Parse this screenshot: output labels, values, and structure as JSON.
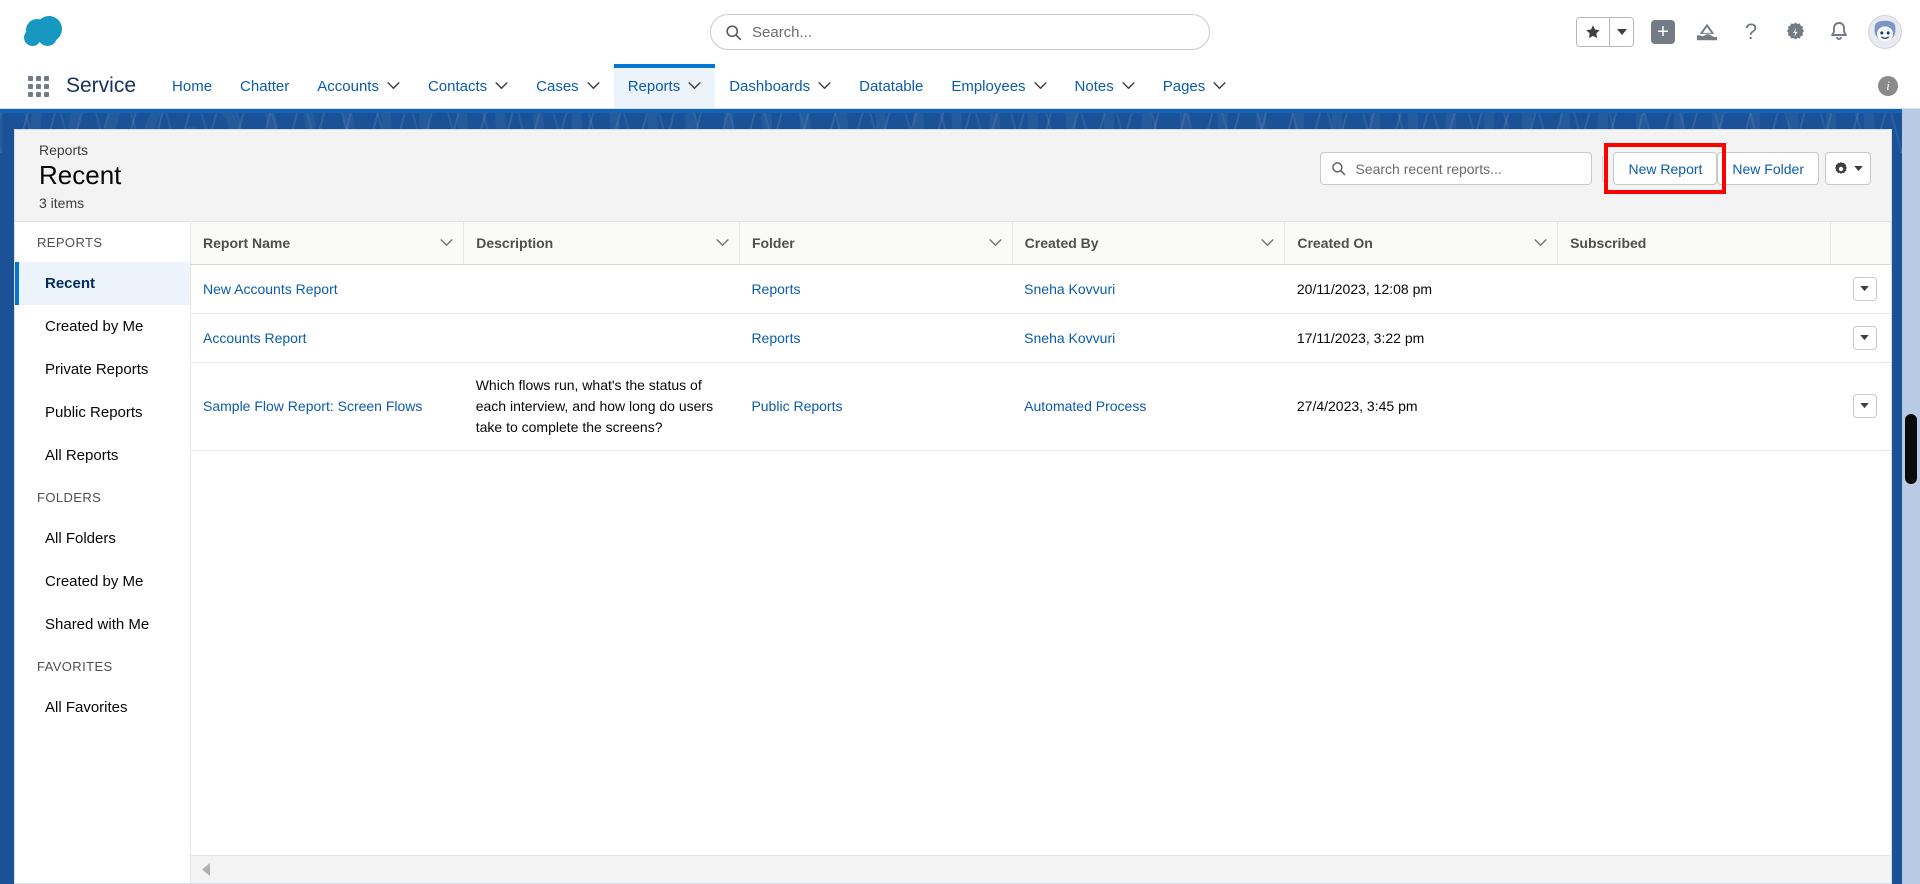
{
  "global": {
    "logo_name": "salesforce-cloud-logo",
    "search_placeholder": "Search...",
    "icons": [
      {
        "name": "favorites-star-icon",
        "label": "Favorites"
      },
      {
        "name": "favorites-caret-icon",
        "label": "Favorites list"
      },
      {
        "name": "add-plus-icon",
        "label": "Global Actions"
      },
      {
        "name": "trailhead-icon",
        "label": "Trailhead"
      },
      {
        "name": "help-question-icon",
        "label": "Help"
      },
      {
        "name": "setup-gear-icon",
        "label": "Setup"
      },
      {
        "name": "notifications-bell-icon",
        "label": "Notifications"
      },
      {
        "name": "user-avatar",
        "label": "User profile"
      }
    ]
  },
  "appnav": {
    "waffle_label": "App Launcher",
    "app_name": "Service",
    "info_icon": "info-icon",
    "items": [
      {
        "label": "Home",
        "has_menu": false,
        "active": false
      },
      {
        "label": "Chatter",
        "has_menu": false,
        "active": false
      },
      {
        "label": "Accounts",
        "has_menu": true,
        "active": false
      },
      {
        "label": "Contacts",
        "has_menu": true,
        "active": false
      },
      {
        "label": "Cases",
        "has_menu": true,
        "active": false
      },
      {
        "label": "Reports",
        "has_menu": true,
        "active": true
      },
      {
        "label": "Dashboards",
        "has_menu": true,
        "active": false
      },
      {
        "label": "Datatable",
        "has_menu": false,
        "active": false
      },
      {
        "label": "Employees",
        "has_menu": true,
        "active": false
      },
      {
        "label": "Notes",
        "has_menu": true,
        "active": false
      },
      {
        "label": "Pages",
        "has_menu": true,
        "active": false
      }
    ]
  },
  "page": {
    "breadcrumb": "Reports",
    "title": "Recent",
    "item_count": "3 items",
    "search_placeholder": "Search recent reports...",
    "new_report_label": "New Report",
    "new_folder_label": "New Folder",
    "gear_label": "List View Controls",
    "highlight_color": "#fe0000",
    "accent_color": "#0176d3",
    "link_color": "#0b5cab"
  },
  "sidebar": {
    "groups": [
      {
        "title": "REPORTS",
        "items": [
          {
            "label": "Recent",
            "active": true
          },
          {
            "label": "Created by Me",
            "active": false
          },
          {
            "label": "Private Reports",
            "active": false
          },
          {
            "label": "Public Reports",
            "active": false
          },
          {
            "label": "All Reports",
            "active": false
          }
        ]
      },
      {
        "title": "FOLDERS",
        "items": [
          {
            "label": "All Folders",
            "active": false
          },
          {
            "label": "Created by Me",
            "active": false
          },
          {
            "label": "Shared with Me",
            "active": false
          }
        ]
      },
      {
        "title": "FAVORITES",
        "items": [
          {
            "label": "All Favorites",
            "active": false
          }
        ]
      }
    ]
  },
  "table": {
    "columns": [
      {
        "label": "Report Name",
        "has_menu": true
      },
      {
        "label": "Description",
        "has_menu": true
      },
      {
        "label": "Folder",
        "has_menu": true
      },
      {
        "label": "Created By",
        "has_menu": true
      },
      {
        "label": "Created On",
        "has_menu": true
      },
      {
        "label": "Subscribed",
        "has_menu": false
      }
    ],
    "rows": [
      {
        "report_name": "New Accounts Report",
        "description": "",
        "folder": "Reports",
        "created_by": "Sneha Kovvuri",
        "created_on": "20/11/2023, 12:08 pm",
        "subscribed": ""
      },
      {
        "report_name": "Accounts Report",
        "description": "",
        "folder": "Reports",
        "created_by": "Sneha Kovvuri",
        "created_on": "17/11/2023, 3:22 pm",
        "subscribed": ""
      },
      {
        "report_name": "Sample Flow Report: Screen Flows",
        "description": "Which flows run, what's the status of each interview, and how long do users take to complete the screens?",
        "folder": "Public Reports",
        "created_by": "Automated Process",
        "created_on": "27/4/2023, 3:45 pm",
        "subscribed": ""
      }
    ],
    "row_menu_icon": "row-actions-dropdown-icon",
    "scroll_left_icon": "scroll-left-arrow-icon"
  }
}
